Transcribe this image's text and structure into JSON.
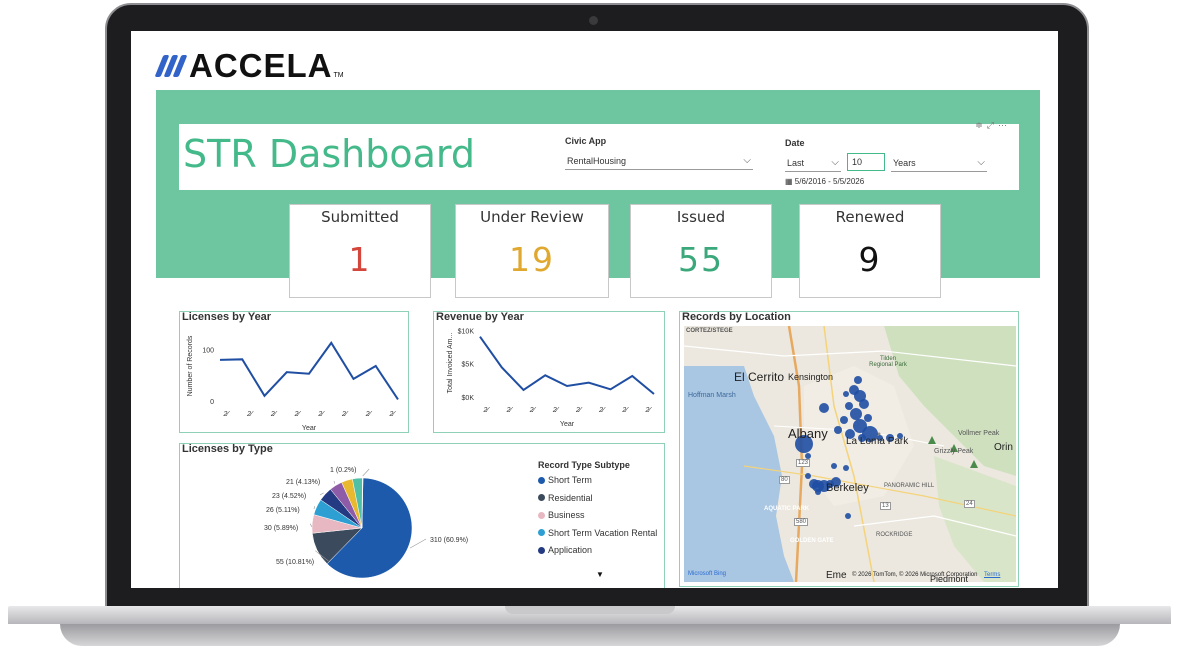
{
  "logo": {
    "text": "ACCELA",
    "tm": "TM",
    "color": "#3263c9"
  },
  "dashboard": {
    "title": "STR Dashboard"
  },
  "filters": {
    "civic_app_label": "Civic App",
    "civic_app_value": "RentalHousing",
    "date_label": "Date",
    "date_mode": "Last",
    "date_count": "10",
    "date_unit": "Years",
    "date_range": "5/6/2016 - 5/5/2026",
    "icons": [
      "filter-icon",
      "expand-icon",
      "more-icon"
    ]
  },
  "kpis": [
    {
      "label": "Submitted",
      "value": "1",
      "color": "#d4453b"
    },
    {
      "label": "Under Review",
      "value": "19",
      "color": "#e0a82e"
    },
    {
      "label": "Issued",
      "value": "55",
      "color": "#3aa87a"
    },
    {
      "label": "Renewed",
      "value": "9",
      "color": "#111111"
    }
  ],
  "licenses_by_year": {
    "title": "Licenses by Year",
    "chart_data": {
      "type": "line",
      "title": "Licenses by Year",
      "xlabel": "Year",
      "ylabel": "Number of Records",
      "ylim": [
        0,
        140
      ],
      "yticks": [
        "100",
        "0"
      ],
      "xticks": [
        "2",
        "2",
        "2",
        "2",
        "2",
        "2",
        "2",
        "2"
      ],
      "values": [
        82,
        83,
        12,
        58,
        55,
        115,
        45,
        70,
        5
      ],
      "color": "#1f4ea3"
    }
  },
  "revenue_by_year": {
    "title": "Revenue by Year",
    "chart_data": {
      "type": "line",
      "title": "Revenue by Year",
      "xlabel": "Year",
      "ylabel": "Total Invoiced Am...",
      "ylim": [
        0,
        10500
      ],
      "yticks": [
        "$10K",
        "$5K",
        "$0K"
      ],
      "xticks": [
        "2",
        "2",
        "2",
        "2",
        "2",
        "2",
        "2",
        "2"
      ],
      "values": [
        9200,
        4600,
        1200,
        3400,
        1800,
        2300,
        1300,
        3300,
        600
      ],
      "color": "#1f4ea3"
    }
  },
  "licenses_by_type": {
    "title": "Licenses by Type",
    "chart_data": {
      "type": "pie",
      "title": "Licenses by Type",
      "legend_title": "Record Type Subtype",
      "slices": [
        {
          "label": "310 (60.9%)",
          "value": 310,
          "color": "#1d5aab"
        },
        {
          "label": "55 (10.81%)",
          "value": 55,
          "color": "#3b4a5c"
        },
        {
          "label": "30 (5.89%)",
          "value": 30,
          "color": "#e8b8c2"
        },
        {
          "label": "26 (5.11%)",
          "value": 26,
          "color": "#2d9fd3"
        },
        {
          "label": "23 (4.52%)",
          "value": 23,
          "color": "#243a82"
        },
        {
          "label": "21 (4.13%)",
          "value": 21,
          "color": "#8e5ba8"
        },
        {
          "label": "",
          "value": 18,
          "color": "#e8b82e"
        },
        {
          "label": "",
          "value": 16,
          "color": "#4fbfa6"
        },
        {
          "label": "1 (0.2%)",
          "value": 1,
          "color": "#c8c8c8"
        }
      ]
    },
    "legend": [
      {
        "label": "Short Term",
        "color": "#1d5aab"
      },
      {
        "label": "Residential",
        "color": "#3b4a5c"
      },
      {
        "label": "Business",
        "color": "#e8b8c2"
      },
      {
        "label": "Short Term Vacation Rental",
        "color": "#2d9fd3"
      },
      {
        "label": "Application",
        "color": "#243a82"
      }
    ],
    "more_arrow": "▼"
  },
  "records_by_location": {
    "title": "Records by Location",
    "places": {
      "cortez": "CORTEZ/STEGE",
      "el_cerrito": "El Cerrito",
      "kensington": "Kensington",
      "tilden": "Tilden Regional Park",
      "hoffman": "Hoffman Marsh",
      "albany": "Albany",
      "la_loma": "La Loma Park",
      "grizzly": "Grizzly Peak",
      "volmer": "Vollmer Peak",
      "orinda": "Orin",
      "berkeley": "Berkeley",
      "panoramic": "PANORAMIC HILL",
      "aquatic": "AQUATIC PARK",
      "golden_gate": "GOLDEN GATE",
      "rockridge": "ROCKRIDGE",
      "piedmont": "Piedmont",
      "emeryville": "Eme"
    },
    "shields": [
      "123",
      "13",
      "24",
      "580",
      "80"
    ],
    "attribution": "© 2026 TomTom, © 2026 Microsoft Corporation",
    "terms": "Terms",
    "provider": "Microsoft Bing",
    "point_color": "#1f4ea3"
  }
}
